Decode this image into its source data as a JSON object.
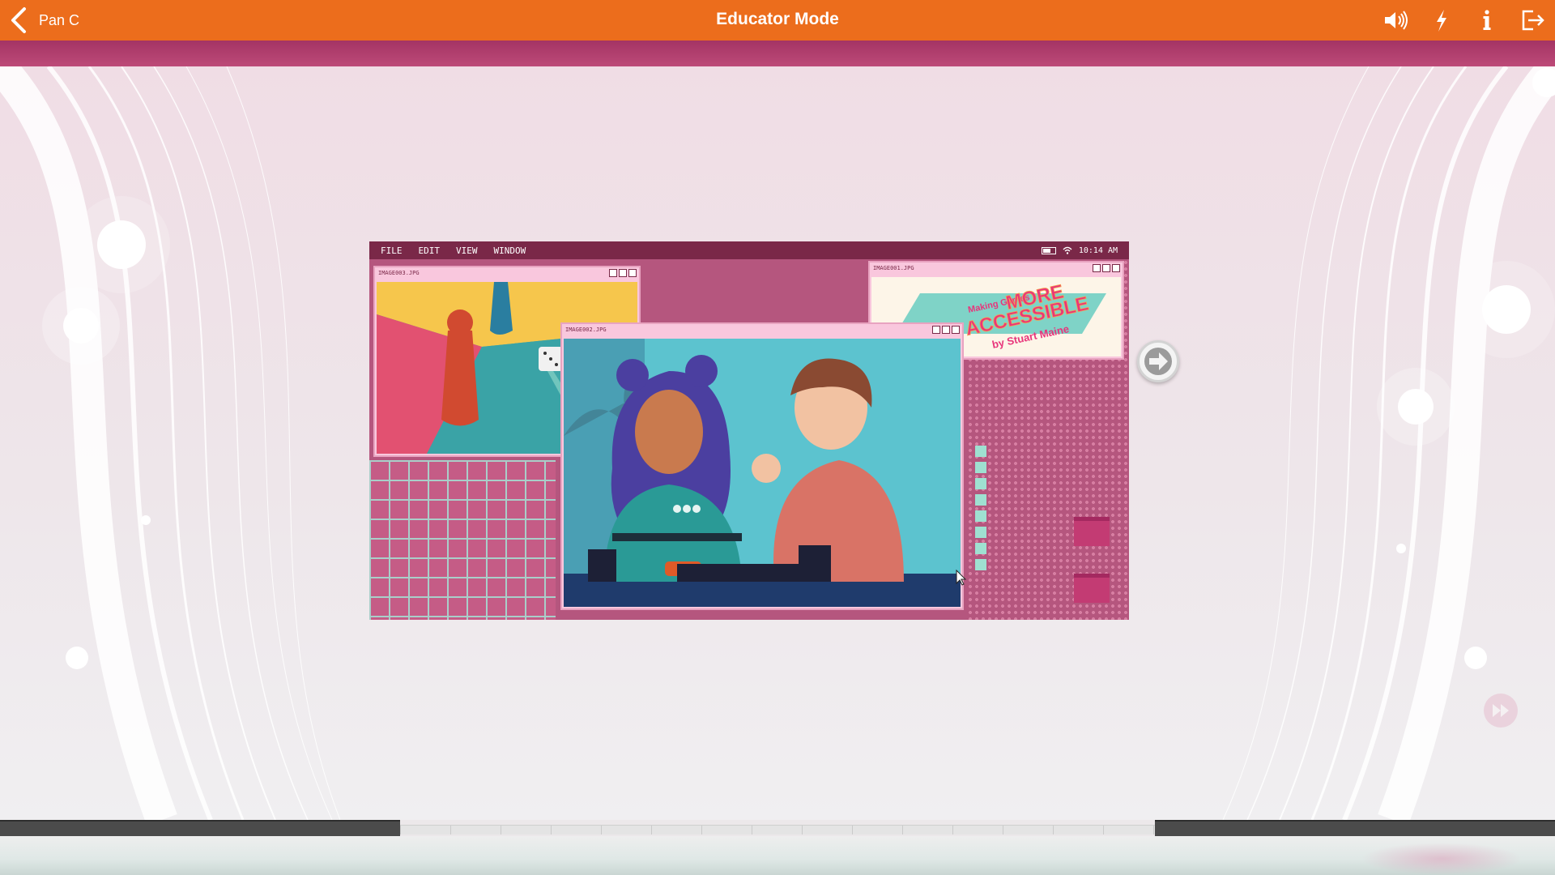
{
  "topbar": {
    "back_label": "Pan C",
    "title": "Educator Mode",
    "icons": [
      "back-chevron-icon",
      "speaker-icon",
      "lightning-icon",
      "info-icon",
      "exit-icon"
    ],
    "color": "#ec6d1c"
  },
  "accent_strip_color": "#a43464",
  "slide": {
    "menu": [
      "FILE",
      "EDIT",
      "VIEW",
      "WINDOW"
    ],
    "clock": "10:14 AM",
    "windows": [
      {
        "title": "IMAGE003.JPG"
      },
      {
        "title": "IMAGE002.JPG"
      },
      {
        "title": "IMAGE001.JPG"
      }
    ],
    "book": {
      "line1": "Making Games",
      "line2": "MORE",
      "line3": "ACCESSIBLE",
      "author": "by Stuart Maine"
    }
  },
  "controls": {
    "next_icon": "arrow-right-circle-icon",
    "fast_forward_icon": "fast-forward-icon"
  }
}
